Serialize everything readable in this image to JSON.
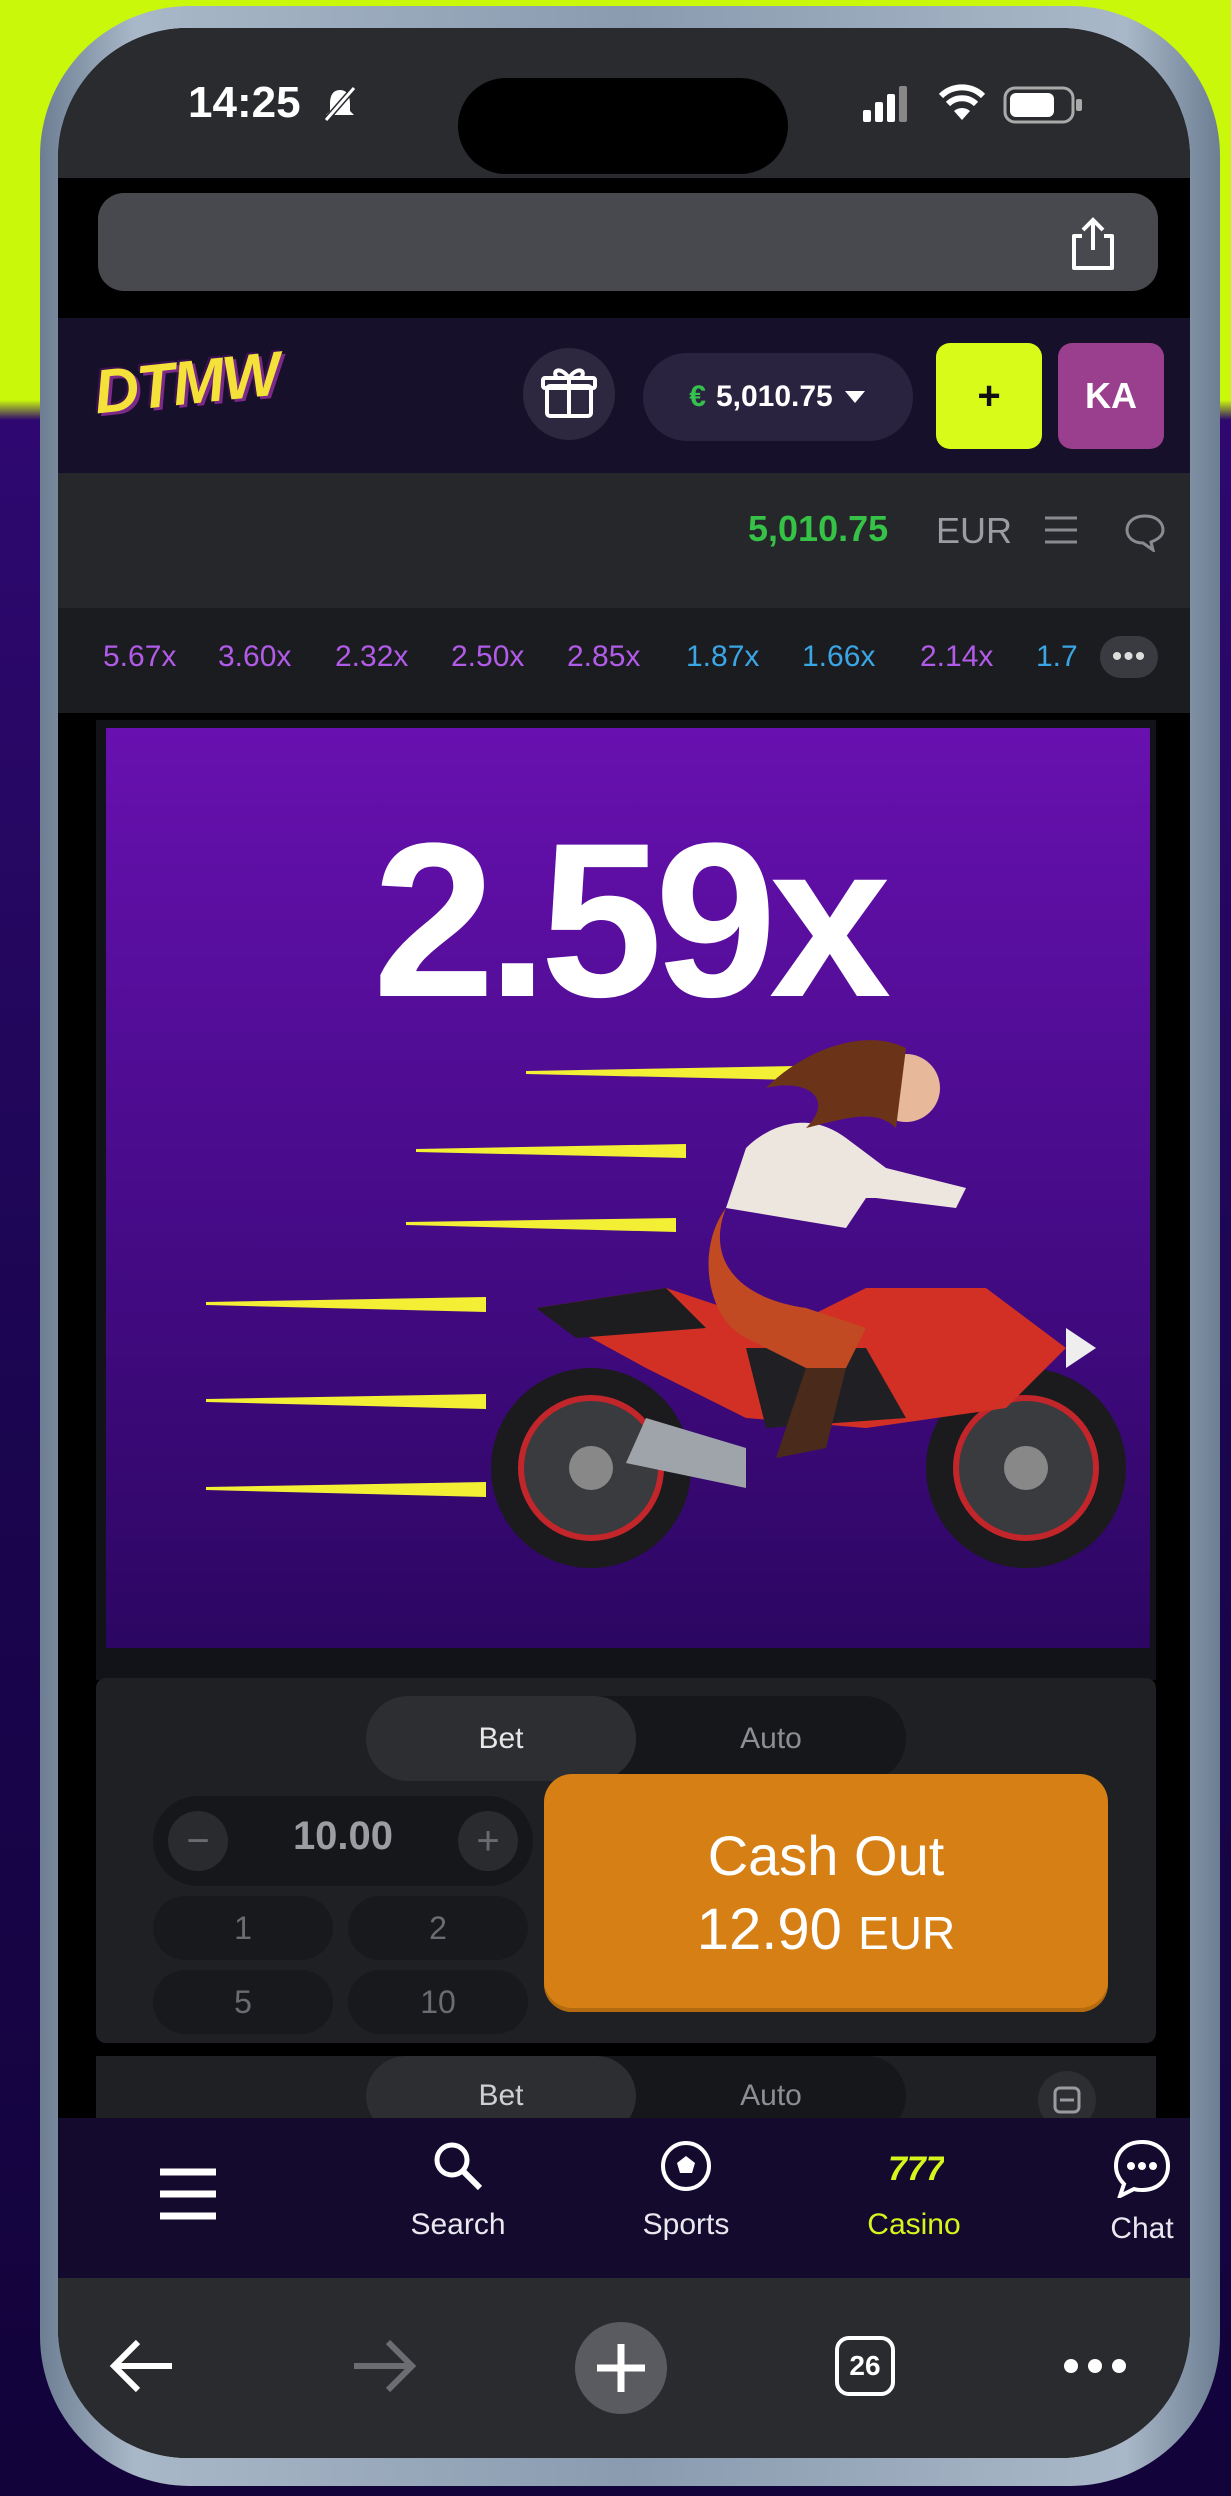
{
  "status": {
    "time": "14:25"
  },
  "header": {
    "logo_text": "DTMW",
    "balance_currency_symbol": "€",
    "balance": "5,010.75",
    "deposit_label": "+",
    "avatar_initials": "KA"
  },
  "game_header": {
    "balance": "5,010.75",
    "currency": "EUR"
  },
  "multiplier_history": [
    {
      "value": "5.67x",
      "color": "#b25be8"
    },
    {
      "value": "3.60x",
      "color": "#b25be8"
    },
    {
      "value": "2.32x",
      "color": "#b25be8"
    },
    {
      "value": "2.50x",
      "color": "#b25be8"
    },
    {
      "value": "2.85x",
      "color": "#b25be8"
    },
    {
      "value": "1.87x",
      "color": "#3aa6e6"
    },
    {
      "value": "1.66x",
      "color": "#3aa6e6"
    },
    {
      "value": "2.14x",
      "color": "#b25be8"
    },
    {
      "value": "1.7",
      "color": "#3aa6e6"
    }
  ],
  "game": {
    "current_multiplier": "2.59x"
  },
  "bet_panel": {
    "tabs": [
      "Bet",
      "Auto"
    ],
    "amount": "10.00",
    "quick_amounts": [
      "1",
      "2",
      "5",
      "10"
    ],
    "cashout_label": "Cash Out",
    "cashout_amount": "12.90",
    "cashout_currency": "EUR"
  },
  "bet_panel_2": {
    "tabs": [
      "Bet",
      "Auto"
    ]
  },
  "bottom_nav": [
    {
      "label": "",
      "icon": "hamburger-menu-icon"
    },
    {
      "label": "Search",
      "icon": "search-icon"
    },
    {
      "label": "Sports",
      "icon": "soccer-ball-icon"
    },
    {
      "label": "Casino",
      "icon": "slot-777-icon",
      "active": true
    },
    {
      "label": "Chat",
      "icon": "chat-bubble-icon"
    }
  ],
  "browser": {
    "tab_count": "26"
  },
  "colors": {
    "accent": "#d9fb19",
    "cashout": "#d57f14",
    "balance_green": "#36c247",
    "arena_purple": "#5a0fa0"
  }
}
